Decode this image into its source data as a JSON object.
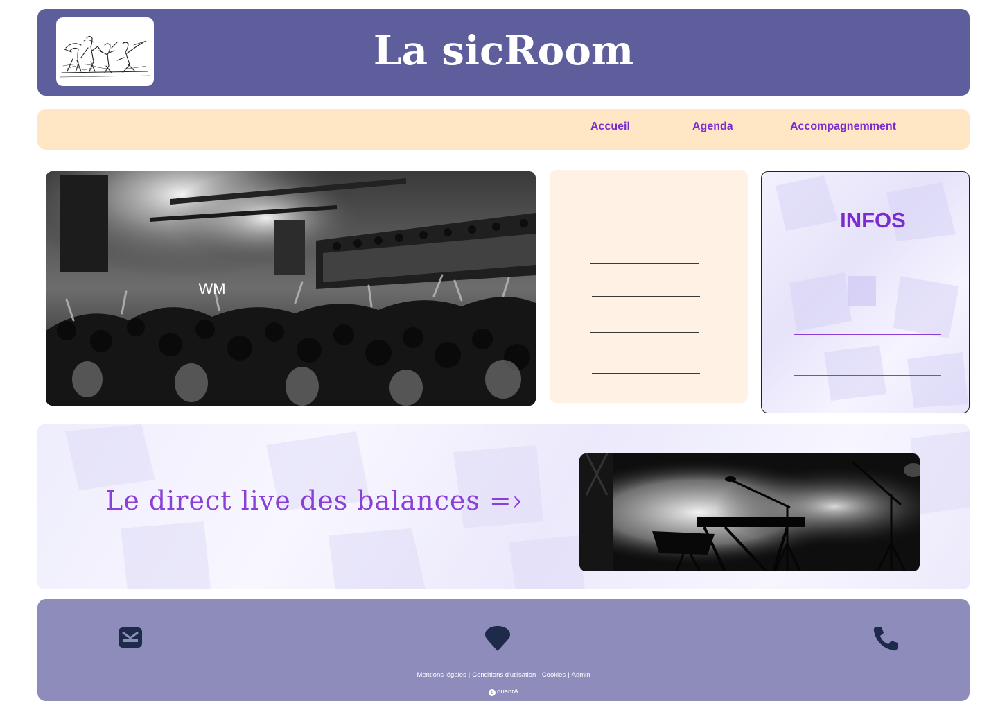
{
  "header": {
    "title": "La sicRoom",
    "bg_color": "#5f5e9d"
  },
  "nav": {
    "items": [
      {
        "label": "Accueil"
      },
      {
        "label": "Agenda"
      },
      {
        "label": "Accompagnemment"
      }
    ],
    "bg_color": "#ffe7c6",
    "link_color": "#7b2ccf"
  },
  "hero": {
    "overlay_text": "WM"
  },
  "infos": {
    "title": "INFOS"
  },
  "live": {
    "text": "Le direct live des balances =›"
  },
  "footer": {
    "icons": [
      "mail-icon",
      "location-pin-icon",
      "phone-icon"
    ],
    "links": [
      "Mentions légales",
      "Conditions d'utlisation",
      "Cookies",
      "Admin"
    ],
    "separator": "|",
    "copyright": "duanrA",
    "bg_color": "#8d8cbb"
  }
}
